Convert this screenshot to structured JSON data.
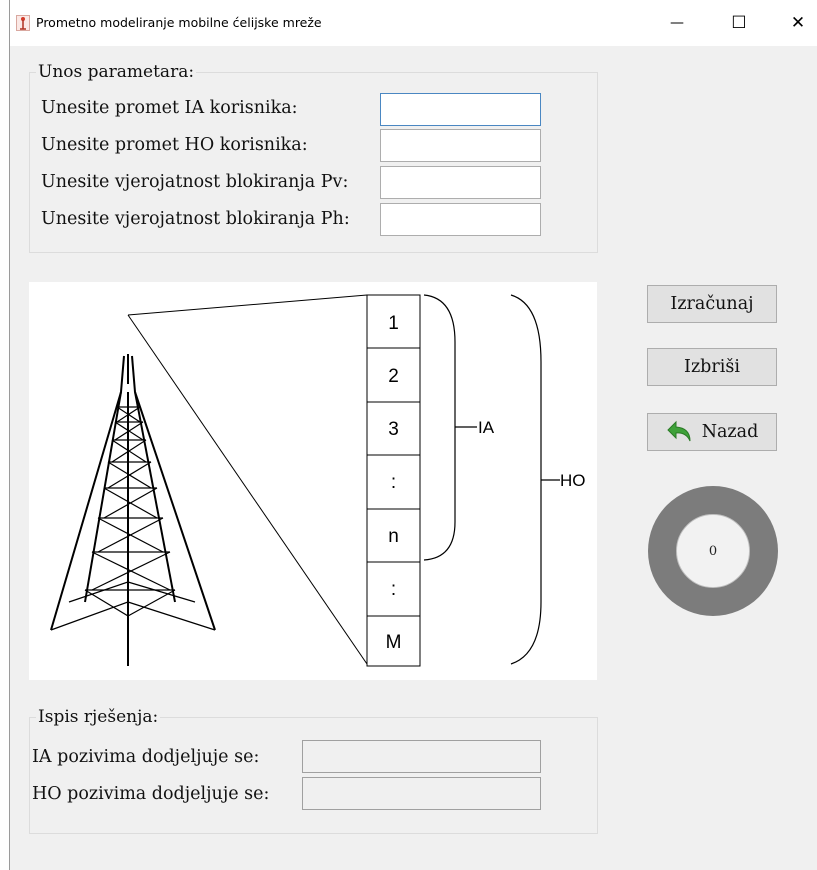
{
  "window": {
    "title": "Prometno modeliranje mobilne ćelijske mreže",
    "minimize_glyph": "—",
    "maximize_glyph": "☐",
    "close_glyph": "✕"
  },
  "input_group": {
    "legend": "Unos parametara:",
    "rows": [
      {
        "label": "Unesite promet IA korisnika:",
        "value": ""
      },
      {
        "label": "Unesite promet HO korisnika:",
        "value": ""
      },
      {
        "label": "Unesite vjerojatnost blokiranja Pv:",
        "value": ""
      },
      {
        "label": "Unesite vjerojatnost blokiranja Ph:",
        "value": ""
      }
    ]
  },
  "diagram": {
    "channels": [
      "1",
      "2",
      "3",
      ":",
      "n",
      ":",
      "M"
    ],
    "brace_ia_label": "IA",
    "brace_ho_label": "HO"
  },
  "buttons": {
    "calculate": "Izračunaj",
    "clear": "Izbriši",
    "back": "Nazad"
  },
  "dial": {
    "value": "0"
  },
  "output_group": {
    "legend": "Ispis rješenja:",
    "rows": [
      {
        "label": "IA pozivima dodjeljuje se:",
        "value": ""
      },
      {
        "label": "HO pozivima dodjeljuje se:",
        "value": ""
      }
    ]
  },
  "icons": {
    "app": "antenna-icon",
    "back": "back-arrow-icon"
  },
  "colors": {
    "back_arrow": "#3fa13a",
    "dial_ring": "#7c7c7c",
    "focus_border": "#4a87c2"
  }
}
